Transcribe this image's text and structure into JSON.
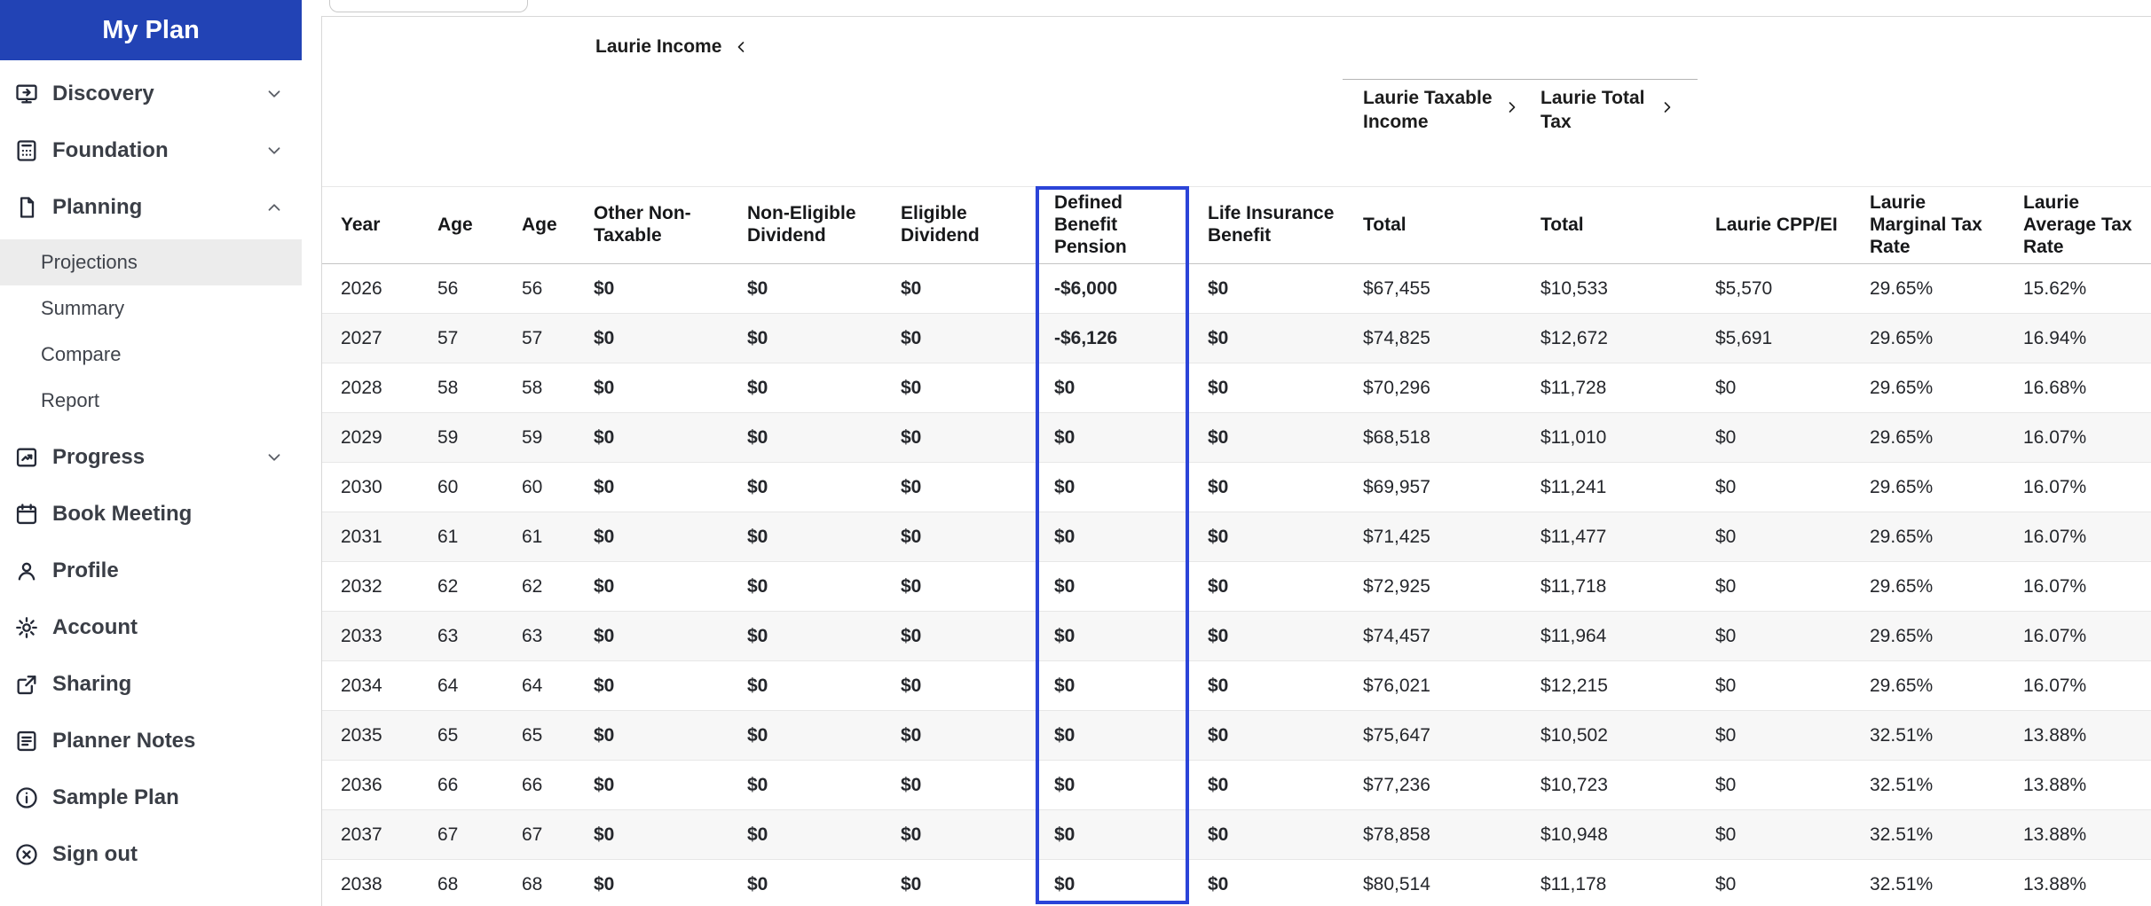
{
  "sidebar": {
    "title": "My Plan",
    "items": [
      {
        "label": "Discovery",
        "icon": "discovery-icon",
        "chevron": "down"
      },
      {
        "label": "Foundation",
        "icon": "foundation-icon",
        "chevron": "down"
      },
      {
        "label": "Planning",
        "icon": "planning-icon",
        "chevron": "up",
        "expanded": true,
        "children": [
          {
            "label": "Projections",
            "active": true
          },
          {
            "label": "Summary"
          },
          {
            "label": "Compare"
          },
          {
            "label": "Report"
          }
        ]
      },
      {
        "label": "Progress",
        "icon": "progress-icon",
        "chevron": "down"
      },
      {
        "label": "Book Meeting",
        "icon": "calendar-icon"
      },
      {
        "label": "Profile",
        "icon": "profile-icon"
      },
      {
        "label": "Account",
        "icon": "gear-icon"
      },
      {
        "label": "Sharing",
        "icon": "share-icon"
      },
      {
        "label": "Planner Notes",
        "icon": "notes-icon"
      },
      {
        "label": "Sample Plan",
        "icon": "info-icon"
      },
      {
        "label": "Sign out",
        "icon": "sign-out-icon"
      }
    ]
  },
  "content": {
    "laurie_income_label": "Laurie Income",
    "laurie_taxable_income_label": "Laurie Taxable Income",
    "laurie_total_tax_label": "Laurie Total Tax"
  },
  "table": {
    "columns": [
      {
        "key": "year",
        "label": "Year",
        "cell_class": "c-dark"
      },
      {
        "key": "age1",
        "label": "Age",
        "cell_class": "c-dark"
      },
      {
        "key": "age2",
        "label": "Age",
        "cell_class": "c-dark"
      },
      {
        "key": "other_non_taxable",
        "label": "Other Non-Taxable",
        "cell_class": "c-blue"
      },
      {
        "key": "non_eligible_dividend",
        "label": "Non-Eligible Dividend",
        "cell_class": "c-blue"
      },
      {
        "key": "eligible_dividend",
        "label": "Eligible Dividend",
        "cell_class": "c-blue"
      },
      {
        "key": "defined_benefit_pension",
        "label": "Defined Benefit Pension",
        "cell_class": "dbp"
      },
      {
        "key": "life_insurance_benefit",
        "label": "Life Insurance Benefit",
        "cell_class": "c-blue"
      },
      {
        "key": "taxable_income_total",
        "label": "Total",
        "cell_class": "c-dark"
      },
      {
        "key": "total_tax_total",
        "label": "Total",
        "cell_class": "c-dark"
      },
      {
        "key": "laurie_cpp_ei",
        "label": "Laurie CPP/EI",
        "cell_class": "c-dark"
      },
      {
        "key": "laurie_marginal_tax_rate",
        "label": "Laurie Marginal Tax Rate",
        "cell_class": "c-dark"
      },
      {
        "key": "laurie_average_tax_rate",
        "label": "Laurie Average Tax Rate",
        "cell_class": "c-dark"
      }
    ],
    "rows": [
      {
        "year": "2026",
        "age1": "56",
        "age2": "56",
        "other_non_taxable": "$0",
        "non_eligible_dividend": "$0",
        "eligible_dividend": "$0",
        "defined_benefit_pension": "-$6,000",
        "life_insurance_benefit": "$0",
        "taxable_income_total": "$67,455",
        "total_tax_total": "$10,533",
        "laurie_cpp_ei": "$5,570",
        "laurie_marginal_tax_rate": "29.65%",
        "laurie_average_tax_rate": "15.62%"
      },
      {
        "year": "2027",
        "age1": "57",
        "age2": "57",
        "other_non_taxable": "$0",
        "non_eligible_dividend": "$0",
        "eligible_dividend": "$0",
        "defined_benefit_pension": "-$6,126",
        "life_insurance_benefit": "$0",
        "taxable_income_total": "$74,825",
        "total_tax_total": "$12,672",
        "laurie_cpp_ei": "$5,691",
        "laurie_marginal_tax_rate": "29.65%",
        "laurie_average_tax_rate": "16.94%"
      },
      {
        "year": "2028",
        "age1": "58",
        "age2": "58",
        "other_non_taxable": "$0",
        "non_eligible_dividend": "$0",
        "eligible_dividend": "$0",
        "defined_benefit_pension": "$0",
        "life_insurance_benefit": "$0",
        "taxable_income_total": "$70,296",
        "total_tax_total": "$11,728",
        "laurie_cpp_ei": "$0",
        "laurie_marginal_tax_rate": "29.65%",
        "laurie_average_tax_rate": "16.68%"
      },
      {
        "year": "2029",
        "age1": "59",
        "age2": "59",
        "other_non_taxable": "$0",
        "non_eligible_dividend": "$0",
        "eligible_dividend": "$0",
        "defined_benefit_pension": "$0",
        "life_insurance_benefit": "$0",
        "taxable_income_total": "$68,518",
        "total_tax_total": "$11,010",
        "laurie_cpp_ei": "$0",
        "laurie_marginal_tax_rate": "29.65%",
        "laurie_average_tax_rate": "16.07%"
      },
      {
        "year": "2030",
        "age1": "60",
        "age2": "60",
        "other_non_taxable": "$0",
        "non_eligible_dividend": "$0",
        "eligible_dividend": "$0",
        "defined_benefit_pension": "$0",
        "life_insurance_benefit": "$0",
        "taxable_income_total": "$69,957",
        "total_tax_total": "$11,241",
        "laurie_cpp_ei": "$0",
        "laurie_marginal_tax_rate": "29.65%",
        "laurie_average_tax_rate": "16.07%"
      },
      {
        "year": "2031",
        "age1": "61",
        "age2": "61",
        "other_non_taxable": "$0",
        "non_eligible_dividend": "$0",
        "eligible_dividend": "$0",
        "defined_benefit_pension": "$0",
        "life_insurance_benefit": "$0",
        "taxable_income_total": "$71,425",
        "total_tax_total": "$11,477",
        "laurie_cpp_ei": "$0",
        "laurie_marginal_tax_rate": "29.65%",
        "laurie_average_tax_rate": "16.07%"
      },
      {
        "year": "2032",
        "age1": "62",
        "age2": "62",
        "other_non_taxable": "$0",
        "non_eligible_dividend": "$0",
        "eligible_dividend": "$0",
        "defined_benefit_pension": "$0",
        "life_insurance_benefit": "$0",
        "taxable_income_total": "$72,925",
        "total_tax_total": "$11,718",
        "laurie_cpp_ei": "$0",
        "laurie_marginal_tax_rate": "29.65%",
        "laurie_average_tax_rate": "16.07%"
      },
      {
        "year": "2033",
        "age1": "63",
        "age2": "63",
        "other_non_taxable": "$0",
        "non_eligible_dividend": "$0",
        "eligible_dividend": "$0",
        "defined_benefit_pension": "$0",
        "life_insurance_benefit": "$0",
        "taxable_income_total": "$74,457",
        "total_tax_total": "$11,964",
        "laurie_cpp_ei": "$0",
        "laurie_marginal_tax_rate": "29.65%",
        "laurie_average_tax_rate": "16.07%"
      },
      {
        "year": "2034",
        "age1": "64",
        "age2": "64",
        "other_non_taxable": "$0",
        "non_eligible_dividend": "$0",
        "eligible_dividend": "$0",
        "defined_benefit_pension": "$0",
        "life_insurance_benefit": "$0",
        "taxable_income_total": "$76,021",
        "total_tax_total": "$12,215",
        "laurie_cpp_ei": "$0",
        "laurie_marginal_tax_rate": "29.65%",
        "laurie_average_tax_rate": "16.07%"
      },
      {
        "year": "2035",
        "age1": "65",
        "age2": "65",
        "other_non_taxable": "$0",
        "non_eligible_dividend": "$0",
        "eligible_dividend": "$0",
        "defined_benefit_pension": "$0",
        "life_insurance_benefit": "$0",
        "taxable_income_total": "$75,647",
        "total_tax_total": "$10,502",
        "laurie_cpp_ei": "$0",
        "laurie_marginal_tax_rate": "32.51%",
        "laurie_average_tax_rate": "13.88%"
      },
      {
        "year": "2036",
        "age1": "66",
        "age2": "66",
        "other_non_taxable": "$0",
        "non_eligible_dividend": "$0",
        "eligible_dividend": "$0",
        "defined_benefit_pension": "$0",
        "life_insurance_benefit": "$0",
        "taxable_income_total": "$77,236",
        "total_tax_total": "$10,723",
        "laurie_cpp_ei": "$0",
        "laurie_marginal_tax_rate": "32.51%",
        "laurie_average_tax_rate": "13.88%"
      },
      {
        "year": "2037",
        "age1": "67",
        "age2": "67",
        "other_non_taxable": "$0",
        "non_eligible_dividend": "$0",
        "eligible_dividend": "$0",
        "defined_benefit_pension": "$0",
        "life_insurance_benefit": "$0",
        "taxable_income_total": "$78,858",
        "total_tax_total": "$10,948",
        "laurie_cpp_ei": "$0",
        "laurie_marginal_tax_rate": "32.51%",
        "laurie_average_tax_rate": "13.88%"
      },
      {
        "year": "2038",
        "age1": "68",
        "age2": "68",
        "other_non_taxable": "$0",
        "non_eligible_dividend": "$0",
        "eligible_dividend": "$0",
        "defined_benefit_pension": "$0",
        "life_insurance_benefit": "$0",
        "taxable_income_total": "$80,514",
        "total_tax_total": "$11,178",
        "laurie_cpp_ei": "$0",
        "laurie_marginal_tax_rate": "32.51%",
        "laurie_average_tax_rate": "13.88%"
      }
    ]
  },
  "colors": {
    "sidebar_header_blue": "#2243b5",
    "editable_value_blue": "#1d53c8",
    "negative_override_red": "#d93025",
    "highlighted_column_border": "#2b44d8",
    "active_sidebar_item_bg": "#ececec"
  }
}
